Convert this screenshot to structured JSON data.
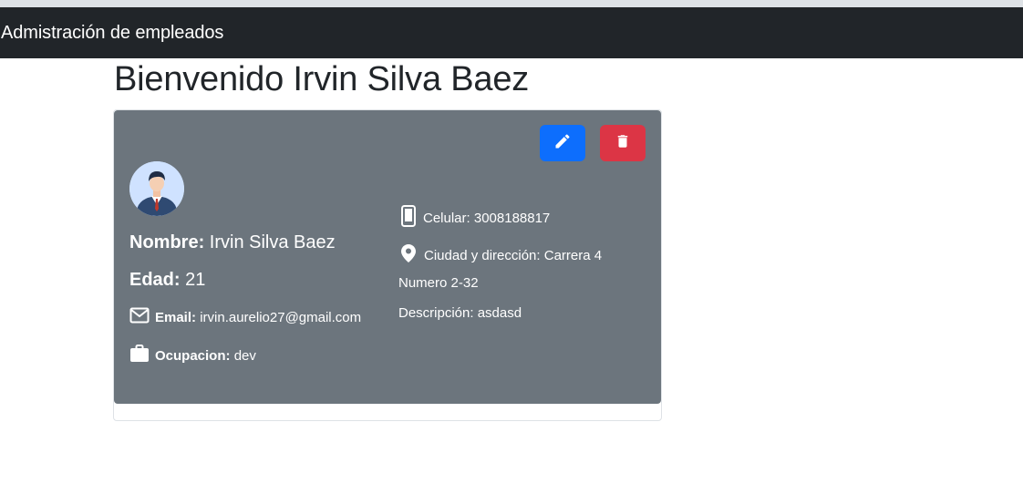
{
  "navbar": {
    "brand": "Admistración de empleados"
  },
  "page": {
    "welcome": "Bienvenido Irvin Silva Baez"
  },
  "employee": {
    "name_label": "Nombre:",
    "name": "Irvin Silva Baez",
    "age_label": "Edad:",
    "age": "21",
    "email_label": "Email:",
    "email": "irvin.aurelio27@gmail.com",
    "job_label": "Ocupacion:",
    "job": "dev",
    "phone_text": "Celular: 3008188817",
    "address_text": "Ciudad y dirección: Carrera 4 Numero 2-32",
    "description_text": "Descripción: asdasd"
  },
  "icons": {
    "edit": "pencil-icon",
    "delete": "trash-icon",
    "email": "envelope-icon",
    "job": "briefcase-icon",
    "phone": "phone-icon",
    "address": "location-pin-icon",
    "avatar": "user-avatar"
  },
  "colors": {
    "navbar": "#212529",
    "card": "#6c757d",
    "edit_button": "#0d6efd",
    "delete_button": "#dc3545"
  }
}
